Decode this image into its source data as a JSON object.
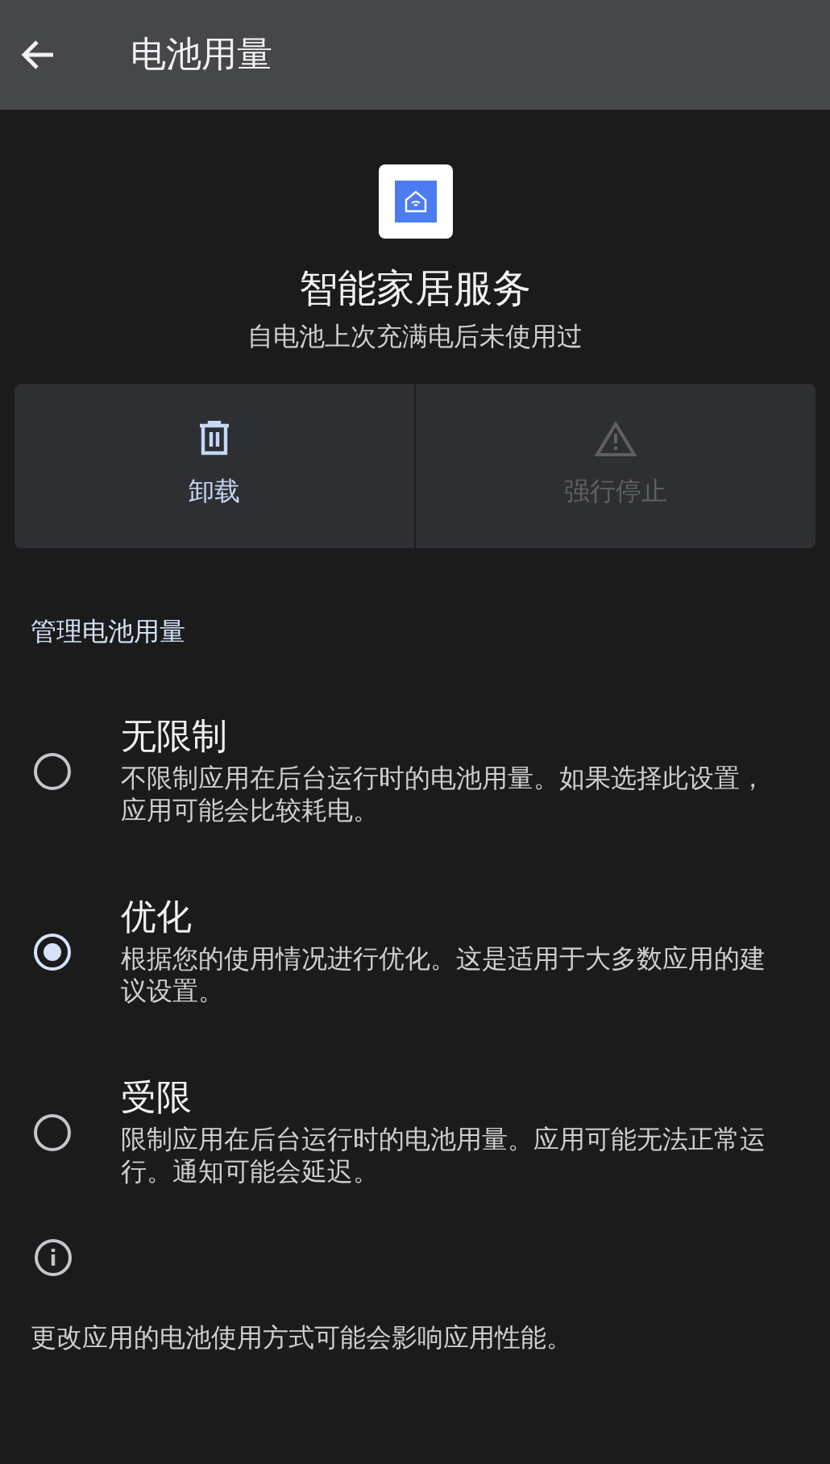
{
  "app_bar": {
    "title": "电池用量"
  },
  "app": {
    "name": "智能家居服务",
    "summary": "自电池上次充满电后未使用过"
  },
  "actions": [
    {
      "kind": "uninstall",
      "label": "卸载",
      "disabled": false
    },
    {
      "kind": "force_stop",
      "label": "强行停止",
      "disabled": true
    }
  ],
  "section": {
    "title": "管理电池用量"
  },
  "options": [
    {
      "title": "无限制",
      "description": "不限制应用在后台运行时的电池用量。如果选择此设置，应用可能会比较耗电。",
      "selected": false
    },
    {
      "title": "优化",
      "description": "根据您的使用情况进行优化。这是适用于大多数应用的建议设置。",
      "selected": true
    },
    {
      "title": "受限",
      "description": "限制应用在后台运行时的电池用量。应用可能无法正常运行。通知可能会延迟。",
      "selected": false
    }
  ],
  "footer": {
    "text": "更改应用的电池使用方式可能会影响应用性能。"
  }
}
